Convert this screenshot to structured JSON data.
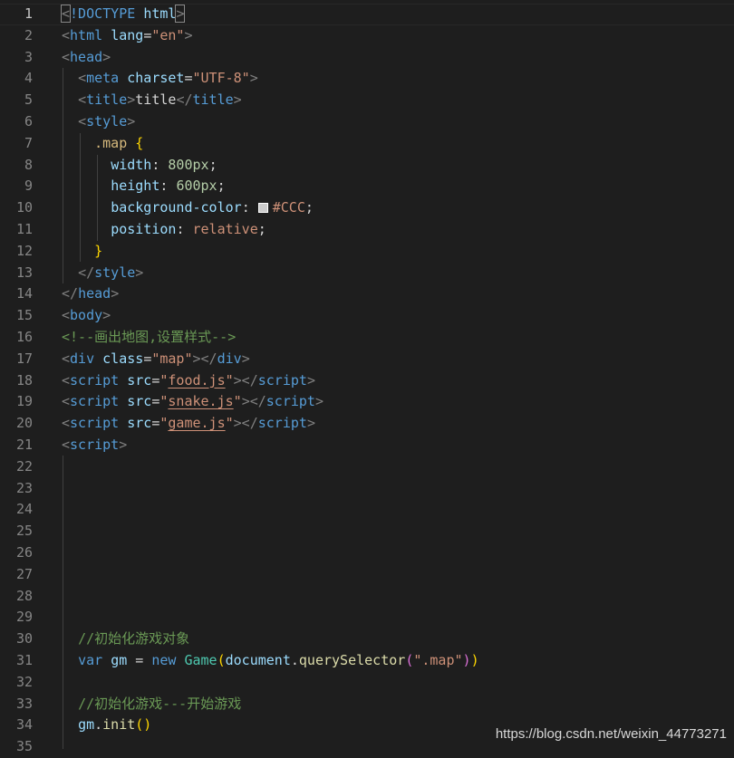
{
  "line_numbers": [
    "1",
    "2",
    "3",
    "4",
    "5",
    "6",
    "7",
    "8",
    "9",
    "10",
    "11",
    "12",
    "13",
    "14",
    "15",
    "16",
    "17",
    "18",
    "19",
    "20",
    "21",
    "22",
    "23",
    "24",
    "25",
    "26",
    "27",
    "28",
    "29",
    "30",
    "31",
    "32",
    "33",
    "34",
    "35"
  ],
  "colors": {
    "swatch": "#CCCCCC"
  },
  "tok": {
    "doctype_kw": "!DOCTYPE",
    "doctype_html": "html",
    "html": "html",
    "lang_attr": "lang",
    "lang_val": "\"en\"",
    "head": "head",
    "meta": "meta",
    "charset_attr": "charset",
    "charset_val": "\"UTF-8\"",
    "title": "title",
    "title_text": "title",
    "style": "style",
    "selector": ".map",
    "width_prop": "width",
    "width_val": "800px",
    "height_prop": "height",
    "height_val": "600px",
    "bg_prop": "background-color",
    "bg_val": "#CCC",
    "pos_prop": "position",
    "pos_val": "relative",
    "body": "body",
    "comment_html": "<!--画出地图,设置样式-->",
    "div": "div",
    "class_attr": "class",
    "class_val": "\"map\"",
    "script": "script",
    "src_attr": "src",
    "src1": "food.js",
    "src2": "snake.js",
    "src3": "game.js",
    "js_comment1": "//初始化游戏对象",
    "var_kw": "var",
    "gm": "gm",
    "new_kw": "new",
    "game_cls": "Game",
    "document": "document",
    "query_fn": "querySelector",
    "query_arg": "\".map\"",
    "js_comment2": "//初始化游戏---开始游戏",
    "gm2": "gm",
    "init_fn": "init"
  },
  "watermark": "https://blog.csdn.net/weixin_44773271"
}
